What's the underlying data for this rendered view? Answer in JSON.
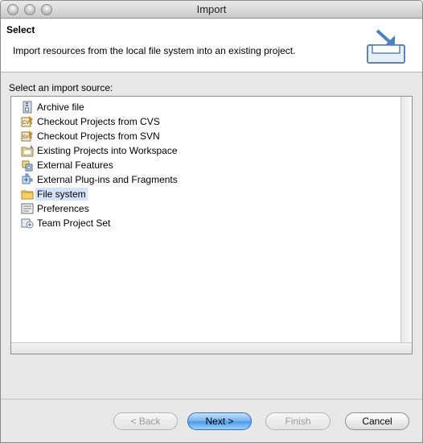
{
  "window": {
    "title": "Import"
  },
  "header": {
    "title": "Select",
    "description": "Import resources from the local file system into an existing project."
  },
  "source_label": "Select an import source:",
  "sources": [
    {
      "label": "Archive file",
      "icon": "archive-icon",
      "selected": false
    },
    {
      "label": "Checkout Projects from CVS",
      "icon": "cvs-icon",
      "selected": false
    },
    {
      "label": "Checkout Projects from SVN",
      "icon": "svn-icon",
      "selected": false
    },
    {
      "label": "Existing Projects into Workspace",
      "icon": "project-icon",
      "selected": false
    },
    {
      "label": "External Features",
      "icon": "feature-icon",
      "selected": false
    },
    {
      "label": "External Plug-ins and Fragments",
      "icon": "plugin-icon",
      "selected": false
    },
    {
      "label": "File system",
      "icon": "folder-icon",
      "selected": true
    },
    {
      "label": "Preferences",
      "icon": "preferences-icon",
      "selected": false
    },
    {
      "label": "Team Project Set",
      "icon": "team-icon",
      "selected": false
    }
  ],
  "buttons": {
    "back": "< Back",
    "next": "Next >",
    "finish": "Finish",
    "cancel": "Cancel"
  }
}
